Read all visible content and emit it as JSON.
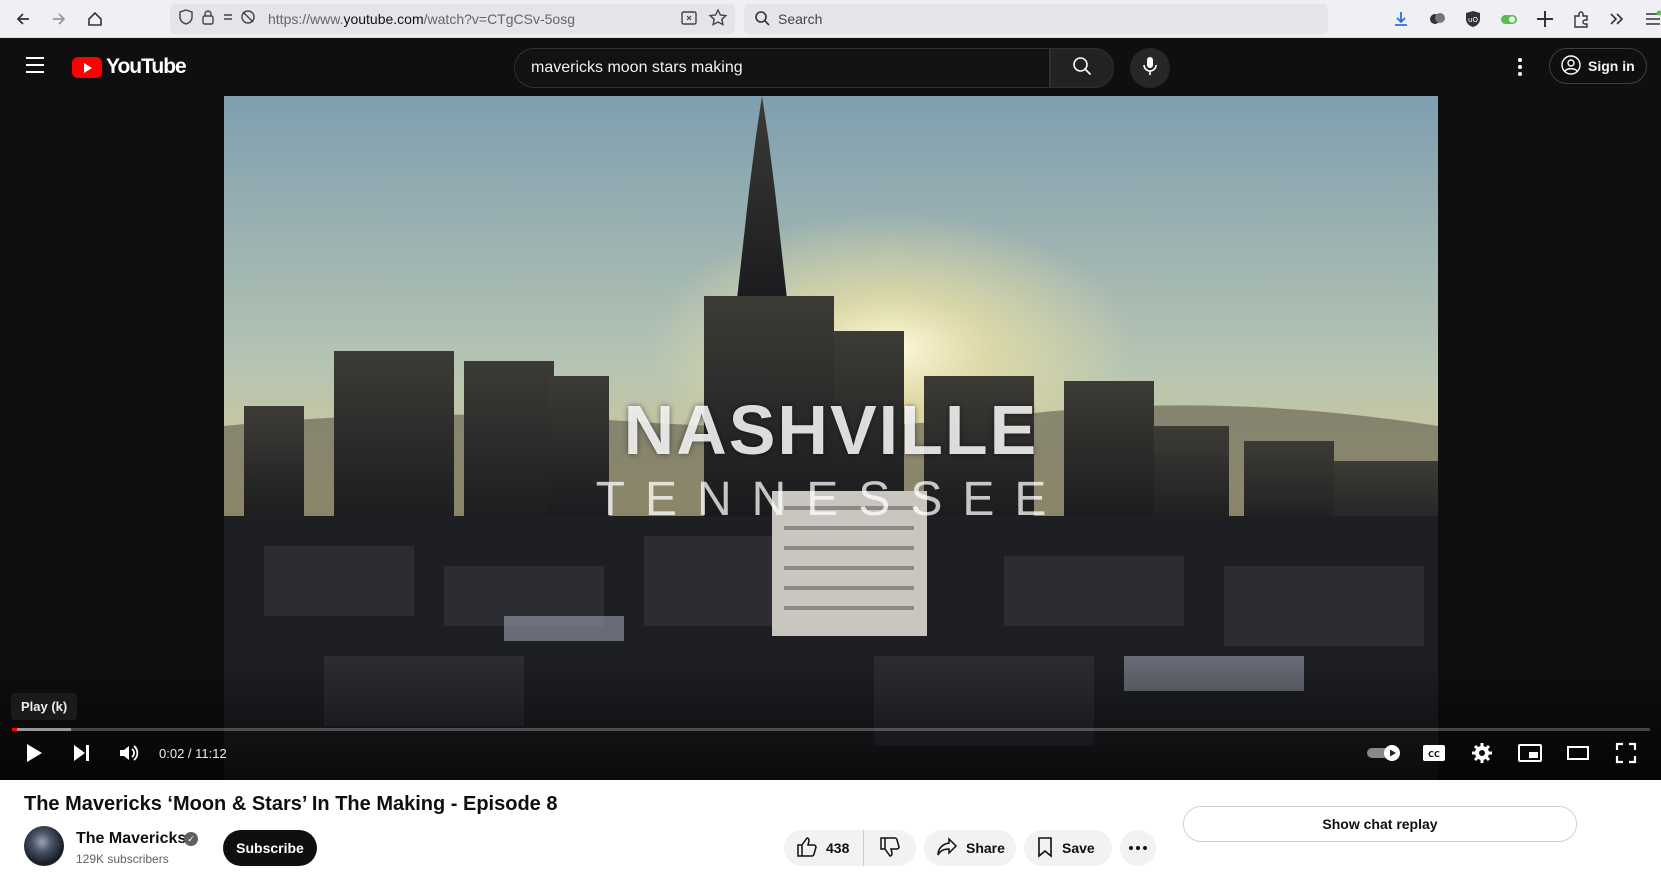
{
  "browser": {
    "url_prefix": "https://www.",
    "url_domain": "youtube.com",
    "url_path": "/watch?v=CTgCSv-5osg",
    "search_placeholder": "Search"
  },
  "header": {
    "logo_text": "YouTube",
    "search_query": "mavericks moon stars making",
    "sign_in_label": "Sign in"
  },
  "player": {
    "overlay_line1": "NASHVILLE",
    "overlay_line2": "TENNESSEE",
    "tooltip": "Play (k)",
    "time_display": "0:02 / 11:12",
    "progress_played": 0.003,
    "progress_buffered": 0.036
  },
  "video": {
    "title": "The Mavericks ‘Moon & Stars’ In The Making - Episode 8",
    "channel_name": "The Mavericks",
    "subscribers": "129K subscribers",
    "subscribe_label": "Subscribe",
    "likes": "438",
    "share_label": "Share",
    "save_label": "Save",
    "chat_replay_label": "Show chat replay"
  },
  "colors": {
    "brand_red": "#ff0000",
    "header_bg": "#0f0f0f",
    "pill_bg": "#f2f2f2"
  }
}
